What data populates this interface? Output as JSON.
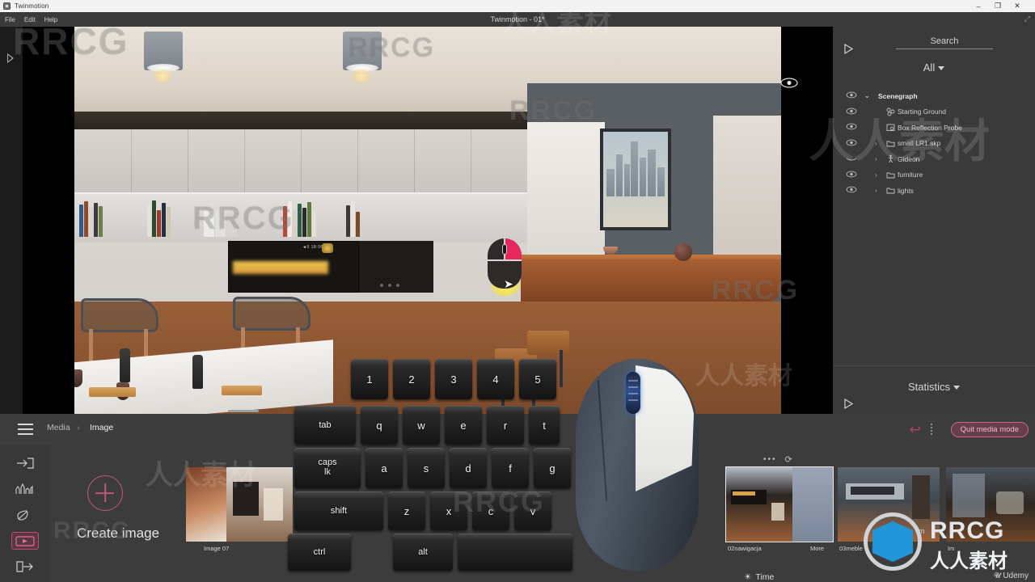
{
  "os": {
    "app_name": "Twinmotion",
    "minimize": "–",
    "maximize": "❐",
    "close": "✕"
  },
  "titlebar": {
    "title": "Twinmotion - 01*",
    "menu": [
      "File",
      "Edit",
      "Help"
    ]
  },
  "viewport": {
    "eye_icon": "eye-icon",
    "left_expand_icon": "expand-arrow-icon",
    "mouse_hint_icon": "mouse-right-button-hint"
  },
  "right_panel": {
    "search_placeholder": "Search",
    "filter_label": "All",
    "collapse_icon": "triangle-right-icon",
    "tree": [
      {
        "label": "Scenegraph",
        "depth": 0,
        "icon": "none",
        "chevron": "v",
        "eye": true,
        "bold": true
      },
      {
        "label": "Starting Ground",
        "depth": 1,
        "icon": "ground-icon",
        "chevron": "",
        "eye": true,
        "bold": false
      },
      {
        "label": "Box Reflection Probe",
        "depth": 1,
        "icon": "probe-icon",
        "chevron": "",
        "eye": true,
        "bold": false
      },
      {
        "label": "small LR1.skp",
        "depth": 1,
        "icon": "folder-icon",
        "chevron": ">",
        "eye": true,
        "bold": false
      },
      {
        "label": "Gideon",
        "depth": 1,
        "icon": "person-icon",
        "chevron": ">",
        "eye": false,
        "bold": false
      },
      {
        "label": "furniture",
        "depth": 1,
        "icon": "folder-icon",
        "chevron": ">",
        "eye": true,
        "bold": false
      },
      {
        "label": "lights",
        "depth": 1,
        "icon": "folder-icon",
        "chevron": ">",
        "eye": true,
        "bold": false
      }
    ],
    "statistics_label": "Statistics"
  },
  "dock": {
    "menu_icon": "hamburger-icon",
    "breadcrumb": {
      "root": "Media",
      "separator": "›",
      "current": "Image"
    },
    "undo_icon": "undo-icon",
    "quit_label": "Quit media mode",
    "rail_icons": [
      "import-icon",
      "urban-icon",
      "vegetation-icon",
      "media-icon",
      "export-icon"
    ],
    "rail_selected_index": 3,
    "create_label": "Create image",
    "create_icon": "plus-circle-icon",
    "strip_tools": [
      "more-dots-icon",
      "refresh-icon"
    ],
    "time_label": "Time",
    "time_icon": "sun-icon",
    "thumbnails": [
      {
        "label": "Image 07",
        "selected": false
      },
      {
        "label": "02nawigacja",
        "selected": true
      },
      {
        "label": "More",
        "selected": false
      },
      {
        "label": "03meble",
        "selected": false
      },
      {
        "label": "Im",
        "selected": false
      }
    ]
  },
  "keyboard": {
    "rows": [
      [
        {
          "label": "1",
          "w": 46
        },
        {
          "label": "2",
          "w": 46
        },
        {
          "label": "3",
          "w": 46
        },
        {
          "label": "4",
          "w": 46
        },
        {
          "label": "5",
          "w": 46
        }
      ],
      [
        {
          "label": "tab",
          "w": 68
        },
        {
          "label": "q",
          "w": 46
        },
        {
          "label": "w",
          "w": 46
        },
        {
          "label": "e",
          "w": 46
        },
        {
          "label": "r",
          "w": 46
        },
        {
          "label": "t",
          "w": 46
        }
      ],
      [
        {
          "label": "caps lk",
          "w": 76
        },
        {
          "label": "a",
          "w": 46
        },
        {
          "label": "s",
          "w": 46
        },
        {
          "label": "d",
          "w": 46
        },
        {
          "label": "f",
          "w": 46
        },
        {
          "label": "g",
          "w": 46
        }
      ],
      [
        {
          "label": "shift",
          "w": 110
        },
        {
          "label": "z",
          "w": 46
        },
        {
          "label": "x",
          "w": 46
        },
        {
          "label": "c",
          "w": 46
        },
        {
          "label": "v",
          "w": 46
        }
      ],
      [
        {
          "label": "ctrl",
          "w": 76
        },
        {
          "label": "alt",
          "w": 74
        },
        {
          "label": "",
          "w": 130
        }
      ]
    ]
  },
  "mouse": {
    "highlighted_button": "right-button",
    "wheel_color": "#2f4d8c"
  },
  "watermarks": {
    "brand": "RRCG",
    "brand_cn": "人人素材",
    "im_prefix": "lm",
    "udemy": "Udemy",
    "tiles": [
      "RRCG",
      "人人素材"
    ]
  },
  "colors": {
    "accent_pink": "#c8486f",
    "panel_bg": "#3a3a3a",
    "dock_bg": "#3c3c3c",
    "brand_blue": "#2196d8"
  }
}
